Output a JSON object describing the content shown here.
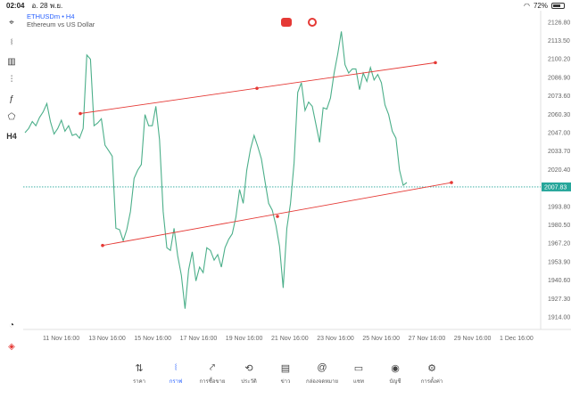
{
  "status": {
    "time": "02:04",
    "date": "อ. 28 พ.ย.",
    "battery": "72%",
    "battery_level": 0.72
  },
  "symbol": {
    "name": "ETHUSDm",
    "sep": "•",
    "timeframe": "H4",
    "description": "Ethereum vs US Dollar"
  },
  "left_tools": [
    {
      "name": "crosshair-icon",
      "glyph": "⌖"
    },
    {
      "name": "candles-icon",
      "glyph": "⧙"
    },
    {
      "name": "bars-icon",
      "glyph": "▥"
    },
    {
      "name": "indicators-icon",
      "glyph": "⫶"
    },
    {
      "name": "function-icon",
      "glyph": "ƒ"
    },
    {
      "name": "objects-icon",
      "glyph": "⬠"
    },
    {
      "name": "timeframe-label",
      "glyph": "H4"
    }
  ],
  "chart_data": {
    "type": "line",
    "current_price": "2007.83",
    "current_price_color": "#26a69a",
    "line_color": "#4caf8a",
    "trendline_color": "#e53935",
    "y_ticks": [
      "2126.80",
      "2113.50",
      "2100.20",
      "2086.90",
      "2073.60",
      "2060.30",
      "2047.00",
      "2033.70",
      "2020.40",
      "1993.80",
      "1980.50",
      "1967.20",
      "1953.90",
      "1940.60",
      "1927.30",
      "1914.00"
    ],
    "y_tick_values": [
      2126.8,
      2113.5,
      2100.2,
      2086.9,
      2073.6,
      2060.3,
      2047.0,
      2033.7,
      2020.4,
      1993.8,
      1980.5,
      1967.2,
      1953.9,
      1940.6,
      1927.3,
      1914.0
    ],
    "x_ticks": [
      "11 Nov 16:00",
      "13 Nov 16:00",
      "15 Nov 16:00",
      "17 Nov 16:00",
      "19 Nov 16:00",
      "21 Nov 16:00",
      "23 Nov 16:00",
      "25 Nov 16:00",
      "27 Nov 16:00",
      "29 Nov 16:00",
      "1 Dec 16:00"
    ],
    "series": [
      {
        "values": [
          2047,
          2050,
          2055,
          2052,
          2058,
          2062,
          2068,
          2055,
          2046,
          2050,
          2056,
          2048,
          2052,
          2045,
          2046,
          2043,
          2050,
          2103,
          2100,
          2052,
          2054,
          2057,
          2038,
          2034,
          2030,
          1978,
          1977,
          1969,
          1977,
          1990,
          2014,
          2020,
          2024,
          2060,
          2052,
          2052,
          2066,
          2042,
          1990,
          1964,
          1962,
          1978,
          1958,
          1944,
          1920,
          1948,
          1961,
          1940,
          1950,
          1946,
          1964,
          1962,
          1955,
          1959,
          1950,
          1964,
          1970,
          1974,
          1986,
          2006,
          1996,
          2020,
          2035,
          2045,
          2037,
          2028,
          2012,
          1996,
          1991,
          1980,
          1965,
          1935,
          1978,
          1996,
          2025,
          2076,
          2083,
          2063,
          2069,
          2066,
          2053,
          2040,
          2065,
          2064,
          2072,
          2090,
          2104,
          2120,
          2096,
          2090,
          2093,
          2093,
          2078,
          2090,
          2084,
          2094,
          2085,
          2089,
          2083,
          2067,
          2060,
          2048,
          2043,
          2020,
          2009,
          2011
        ]
      }
    ],
    "trendlines": [
      {
        "points": [
          [
            0.1,
            2060.8
          ],
          [
            0.5,
            2079
          ],
          [
            0.9,
            2097.5
          ]
        ]
      },
      {
        "points": [
          [
            0.2,
            1965.6
          ],
          [
            0.6,
            1986.6
          ],
          [
            0.9,
            2011
          ]
        ]
      }
    ],
    "ylim": [
      1905,
      2135
    ],
    "grid": false
  },
  "nav": [
    {
      "name": "nav-quotes",
      "icon": "quotes-icon",
      "glyph": "⇅",
      "label": "ราคา",
      "active": false
    },
    {
      "name": "nav-chart",
      "icon": "chart-icon",
      "glyph": "⧙",
      "label": "กราฟ",
      "active": true
    },
    {
      "name": "nav-trade",
      "icon": "trade-icon",
      "glyph": "⤤",
      "label": "การซื้อขาย",
      "active": false
    },
    {
      "name": "nav-history",
      "icon": "history-icon",
      "glyph": "⟲",
      "label": "ประวัติ",
      "active": false
    },
    {
      "name": "nav-news",
      "icon": "news-icon",
      "glyph": "▤",
      "label": "ข่าว",
      "active": false
    },
    {
      "name": "nav-mailbox",
      "icon": "at-icon",
      "glyph": "@",
      "label": "กล่องจดหมาย",
      "active": false
    },
    {
      "name": "nav-chat",
      "icon": "chat-icon",
      "glyph": "▭",
      "label": "แชท",
      "active": false
    },
    {
      "name": "nav-account",
      "icon": "account-icon",
      "glyph": "◉",
      "label": "บัญชี",
      "active": false
    },
    {
      "name": "nav-settings",
      "icon": "gear-icon",
      "glyph": "⚙",
      "label": "การตั้งค่า",
      "active": false
    }
  ]
}
